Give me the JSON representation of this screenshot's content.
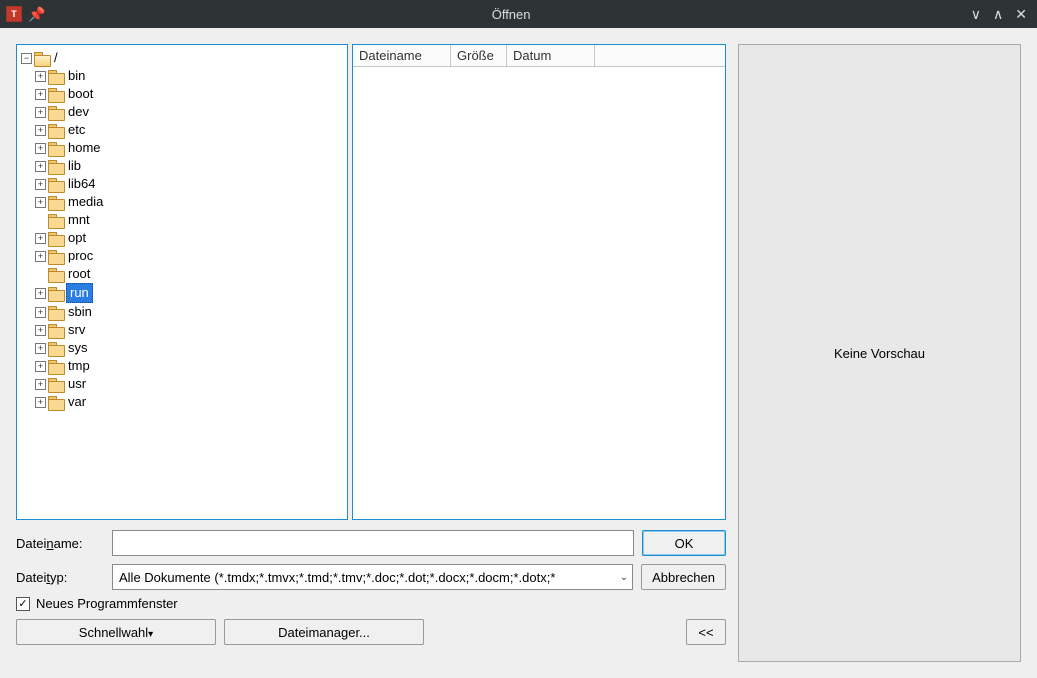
{
  "window": {
    "title": "Öffnen"
  },
  "tree": {
    "root_label": "/",
    "items": [
      {
        "label": "bin",
        "expandable": true
      },
      {
        "label": "boot",
        "expandable": true
      },
      {
        "label": "dev",
        "expandable": true
      },
      {
        "label": "etc",
        "expandable": true
      },
      {
        "label": "home",
        "expandable": true
      },
      {
        "label": "lib",
        "expandable": true
      },
      {
        "label": "lib64",
        "expandable": true
      },
      {
        "label": "media",
        "expandable": true
      },
      {
        "label": "mnt",
        "expandable": false
      },
      {
        "label": "opt",
        "expandable": true
      },
      {
        "label": "proc",
        "expandable": true
      },
      {
        "label": "root",
        "expandable": false
      },
      {
        "label": "run",
        "expandable": true,
        "selected": true
      },
      {
        "label": "sbin",
        "expandable": true
      },
      {
        "label": "srv",
        "expandable": true
      },
      {
        "label": "sys",
        "expandable": true
      },
      {
        "label": "tmp",
        "expandable": true
      },
      {
        "label": "usr",
        "expandable": true
      },
      {
        "label": "var",
        "expandable": true
      }
    ]
  },
  "list": {
    "columns": {
      "name": "Dateiname",
      "size": "Größe",
      "date": "Datum"
    }
  },
  "form": {
    "filename_label_prefix": "Datei",
    "filename_label_ul": "n",
    "filename_label_suffix": "ame:",
    "filename_value": "",
    "filetype_label_prefix": "Datei",
    "filetype_label_ul": "t",
    "filetype_label_suffix": "yp:",
    "filetype_value": "Alle Dokumente (*.tmdx;*.tmvx;*.tmd;*.tmv;*.doc;*.dot;*.docx;*.docm;*.dotx;*",
    "ok_label": "OK",
    "cancel_label": "Abbrechen",
    "new_window_prefix": "Neues Programm",
    "new_window_ul": "f",
    "new_window_suffix": "enster",
    "new_window_checked": true
  },
  "bottom": {
    "quick_prefix": "S",
    "quick_ul": "c",
    "quick_suffix": "hnellwahl",
    "fm_prefix": "Datei",
    "fm_ul": "m",
    "fm_suffix": "anager...",
    "collapse": "<<"
  },
  "preview": {
    "empty_text": "Keine Vorschau"
  }
}
